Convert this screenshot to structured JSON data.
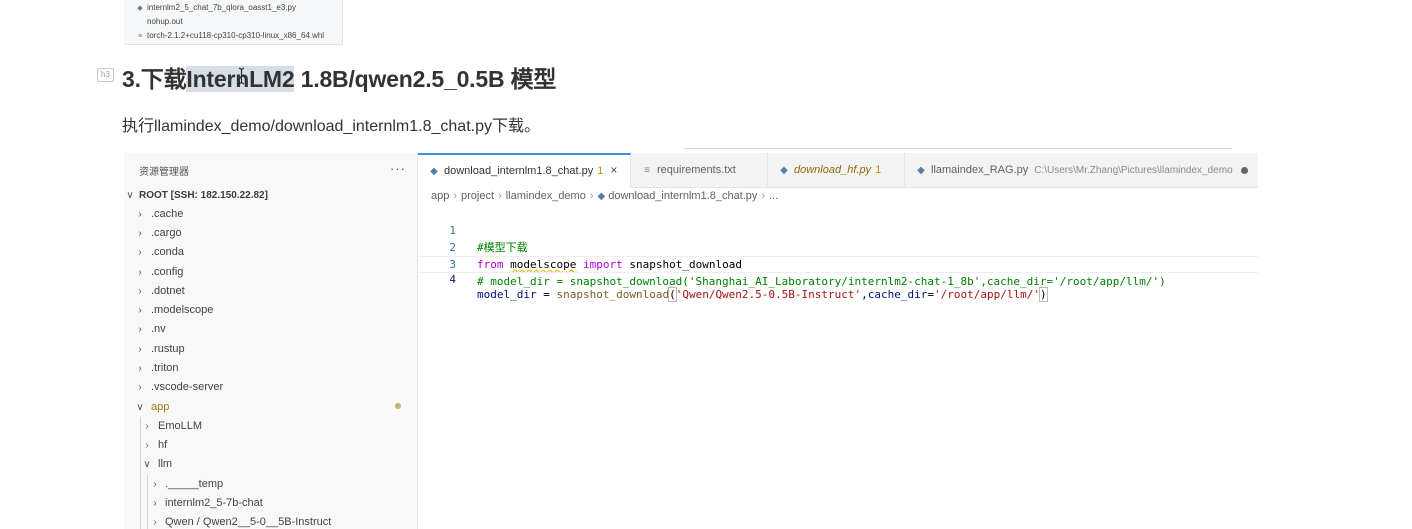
{
  "file_snippet": {
    "items": [
      {
        "icon": "python-file-icon",
        "name": "internlm2_5_chat_7b_qlora_oasst1_e3.py"
      },
      {
        "icon": "file-icon",
        "name": "nohup.out"
      },
      {
        "icon": "text-file-icon",
        "name": "torch-2.1.2+cu118-cp310-cp310-linux_x86_64.whl"
      }
    ]
  },
  "heading": {
    "badge": "h3",
    "prefix": "3.下载",
    "selected": "InternLM2",
    "suffix": " 1.8B/qwen2.5_0.5B 模型"
  },
  "paragraph": "执行llamindex_demo/download_internlm1.8_chat.py下载。",
  "editor": {
    "explorer": {
      "title": "资源管理器",
      "more": "···",
      "root": "ROOT [SSH: 182.150.22.82]",
      "items": [
        ".cache",
        ".cargo",
        ".conda",
        ".config",
        ".dotnet",
        ".modelscope",
        ".nv",
        ".rustup",
        ".triton",
        ".vscode-server"
      ],
      "app": "app",
      "app_children": [
        "EmoLLM",
        "hf",
        "llm"
      ],
      "llm_children": [
        "._____temp",
        "internlm2_5-7b-chat",
        "Qwen / Qwen2__5-0__5B-Instruct"
      ]
    },
    "tabs": [
      {
        "label": "download_internlm1.8_chat.py",
        "badge": "1",
        "close": "×"
      },
      {
        "label": "requirements.txt"
      },
      {
        "label": "download_hf.py",
        "badge": "1"
      },
      {
        "label": "llamaindex_RAG.py",
        "path": "C:\\Users\\Mr.Zhang\\Pictures\\llamindex_demo"
      }
    ],
    "breadcrumb": [
      "app",
      "project",
      "llamindex_demo",
      "download_internlm1.8_chat.py",
      "..."
    ],
    "code_lines": [
      {
        "num": "1",
        "text": "#模型下载"
      },
      {
        "num": "2",
        "kw": "from",
        "mod": "modelscope",
        "kw2": "import",
        "name": "snapshot_download"
      },
      {
        "num": "3",
        "text": "# model_dir = snapshot_download('Shanghai_AI_Laboratory/internlm2-chat-1_8b',cache_dir='/root/app/llm/')"
      },
      {
        "num": "4",
        "var": "model_dir",
        "eq": " = ",
        "fn": "snapshot_download",
        "open": "(",
        "arg1": "'Qwen/Qwen2.5-0.5B-Instruct'",
        "comma": ",",
        "kwarg": "cache_dir",
        "eq2": "=",
        "arg2": "'/root/app/llm/'",
        "close": ")"
      }
    ]
  }
}
